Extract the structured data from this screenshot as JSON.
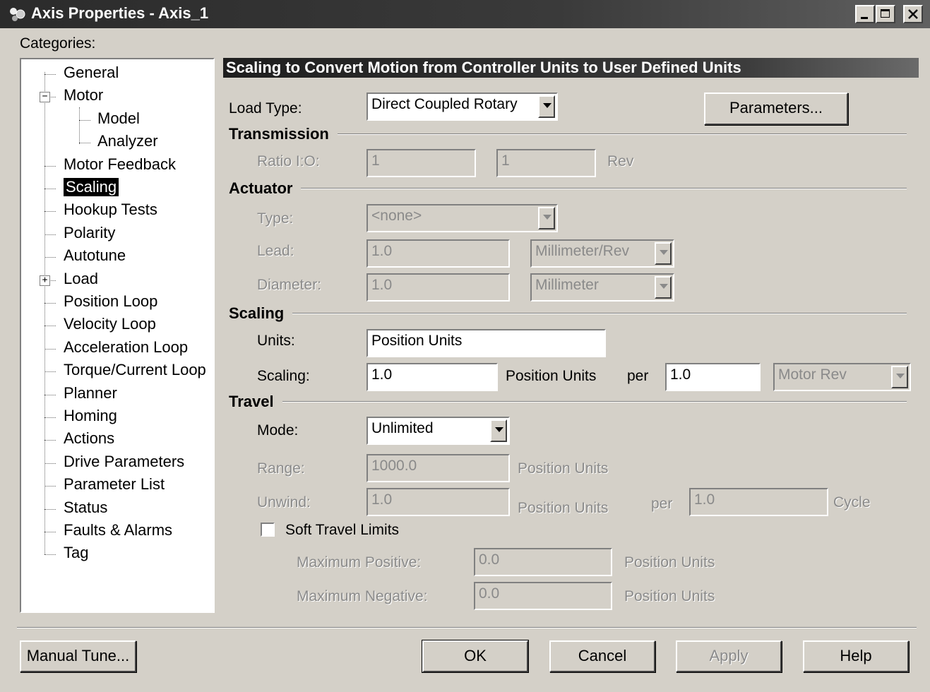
{
  "window": {
    "title": "Axis Properties - Axis_1"
  },
  "categories_label": "Categories:",
  "tree": [
    {
      "label": "General"
    },
    {
      "label": "Motor",
      "expander": "−"
    },
    {
      "label": "Model"
    },
    {
      "label": "Analyzer"
    },
    {
      "label": "Motor Feedback"
    },
    {
      "label": "Scaling",
      "selected": true
    },
    {
      "label": "Hookup Tests"
    },
    {
      "label": "Polarity"
    },
    {
      "label": "Autotune"
    },
    {
      "label": "Load",
      "expander": "+"
    },
    {
      "label": "Position Loop"
    },
    {
      "label": "Velocity Loop"
    },
    {
      "label": "Acceleration Loop"
    },
    {
      "label": "Torque/Current Loop"
    },
    {
      "label": "Planner"
    },
    {
      "label": "Homing"
    },
    {
      "label": "Actions"
    },
    {
      "label": "Drive Parameters"
    },
    {
      "label": "Parameter List"
    },
    {
      "label": "Status"
    },
    {
      "label": "Faults & Alarms"
    },
    {
      "label": "Tag"
    }
  ],
  "header": "Scaling to Convert Motion from Controller Units to User Defined Units",
  "load_type": {
    "label": "Load Type:",
    "value": "Direct Coupled Rotary",
    "parameters_button": "Parameters..."
  },
  "transmission": {
    "title": "Transmission",
    "ratio_label": "Ratio I:O:",
    "ratio_in": "1",
    "ratio_out": "1",
    "unit": "Rev"
  },
  "actuator": {
    "title": "Actuator",
    "type_label": "Type:",
    "type_value": "<none>",
    "lead_label": "Lead:",
    "lead_value": "1.0",
    "lead_unit": "Millimeter/Rev",
    "diameter_label": "Diameter:",
    "diameter_value": "1.0",
    "diameter_unit": "Millimeter"
  },
  "scaling": {
    "title": "Scaling",
    "units_label": "Units:",
    "units_value": "Position Units",
    "scaling_label": "Scaling:",
    "scaling_value": "1.0",
    "scaling_unit": "Position Units",
    "per_label": "per",
    "per_value": "1.0",
    "per_unit": "Motor Rev"
  },
  "travel": {
    "title": "Travel",
    "mode_label": "Mode:",
    "mode_value": "Unlimited",
    "range_label": "Range:",
    "range_value": "1000.0",
    "range_unit": "Position Units",
    "unwind_label": "Unwind:",
    "unwind_value": "1.0",
    "unwind_unit": "Position Units",
    "per_label": "per",
    "per_value": "1.0",
    "per_unit": "Cycle",
    "soft_limits_label": "Soft Travel Limits",
    "soft_limits_checked": false,
    "max_pos_label": "Maximum Positive:",
    "max_pos_value": "0.0",
    "max_pos_unit": "Position Units",
    "max_neg_label": "Maximum Negative:",
    "max_neg_value": "0.0",
    "max_neg_unit": "Position Units"
  },
  "buttons": {
    "manual_tune": "Manual Tune...",
    "ok": "OK",
    "cancel": "Cancel",
    "apply": "Apply",
    "help": "Help"
  }
}
